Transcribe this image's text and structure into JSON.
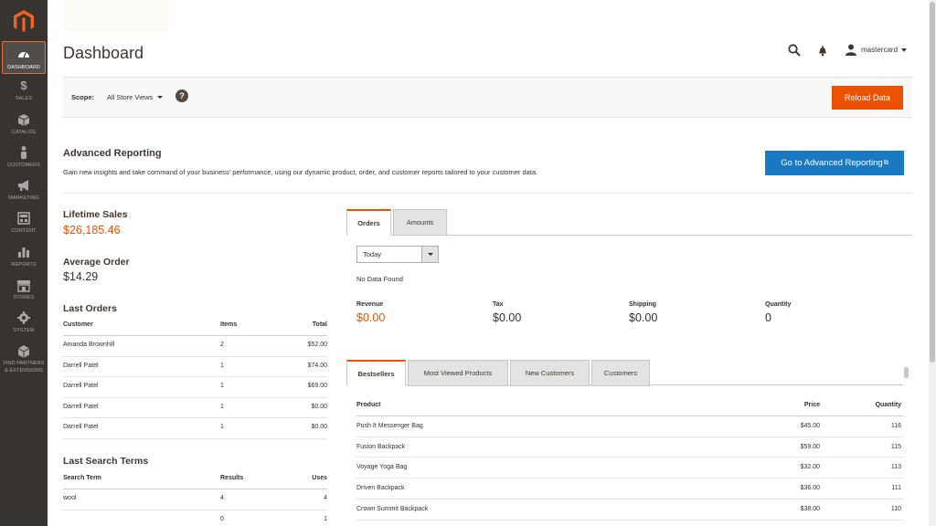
{
  "sidebar": {
    "items": [
      {
        "label": "DASHBOARD",
        "icon": "dashboard-icon"
      },
      {
        "label": "SALES",
        "icon": "dollar-icon"
      },
      {
        "label": "CATALOG",
        "icon": "box-icon"
      },
      {
        "label": "CUSTOMERS",
        "icon": "person-icon"
      },
      {
        "label": "MARKETING",
        "icon": "megaphone-icon"
      },
      {
        "label": "CONTENT",
        "icon": "layout-icon"
      },
      {
        "label": "REPORTS",
        "icon": "bar-chart-icon"
      },
      {
        "label": "STORES",
        "icon": "storefront-icon"
      },
      {
        "label": "SYSTEM",
        "icon": "gear-icon"
      },
      {
        "label": "FIND PARTNERS",
        "label2": "& EXTENSIONS",
        "icon": "cube-icon"
      }
    ]
  },
  "header": {
    "title": "Dashboard",
    "username": "mastercard"
  },
  "scope": {
    "label": "Scope:",
    "value": "All Store Views",
    "help": "?",
    "reload_label": "Reload Data"
  },
  "advanced": {
    "title": "Advanced Reporting",
    "description": "Gain new insights and take command of your business' performance, using our dynamic product, order, and customer reports tailored to your customer data.",
    "button_label": "Go to Advanced Reporting"
  },
  "stats": {
    "lifetime_label": "Lifetime Sales",
    "lifetime_value": "$26,185.46",
    "average_label": "Average Order",
    "average_value": "$14.29"
  },
  "last_orders": {
    "title": "Last Orders",
    "headers": [
      "Customer",
      "Items",
      "Total"
    ],
    "rows": [
      [
        "Amanda Brownhill",
        "2",
        "$52.00"
      ],
      [
        "Darrell Patel",
        "1",
        "$74.00"
      ],
      [
        "Darrell Patel",
        "1",
        "$69.00"
      ],
      [
        "Darrell Patel",
        "1",
        "$0.00"
      ],
      [
        "Darrell Patel",
        "1",
        "$0.00"
      ]
    ]
  },
  "last_search": {
    "title": "Last Search Terms",
    "headers": [
      "Search Term",
      "Results",
      "Uses"
    ],
    "rows": [
      [
        "wool",
        "4",
        "4"
      ],
      [
        "",
        "0",
        "1"
      ]
    ]
  },
  "chart_tabs": [
    "Orders",
    "Amounts"
  ],
  "period": {
    "value": "Today",
    "no_data": "No Data Found"
  },
  "totals": [
    {
      "label": "Revenue",
      "value": "$0.00"
    },
    {
      "label": "Tax",
      "value": "$0.00"
    },
    {
      "label": "Shipping",
      "value": "$0.00"
    },
    {
      "label": "Quantity",
      "value": "0"
    }
  ],
  "product_tabs": [
    "Bestsellers",
    "Most Viewed Products",
    "New Customers",
    "Customers"
  ],
  "bestsellers": {
    "headers": [
      "Product",
      "Price",
      "Quantity"
    ],
    "rows": [
      [
        "Push It Messenger Bag",
        "$45.00",
        "116"
      ],
      [
        "Fusion Backpack",
        "$59.00",
        "115"
      ],
      [
        "Voyage Yoga Bag",
        "$32.00",
        "113"
      ],
      [
        "Driven Backpack",
        "$36.00",
        "111"
      ],
      [
        "Crown Summit Backpack",
        "$38.00",
        "110"
      ]
    ]
  },
  "colors": {
    "accent": "#eb5202",
    "primary_button": "#1979c3",
    "sidebar": "#373330"
  }
}
